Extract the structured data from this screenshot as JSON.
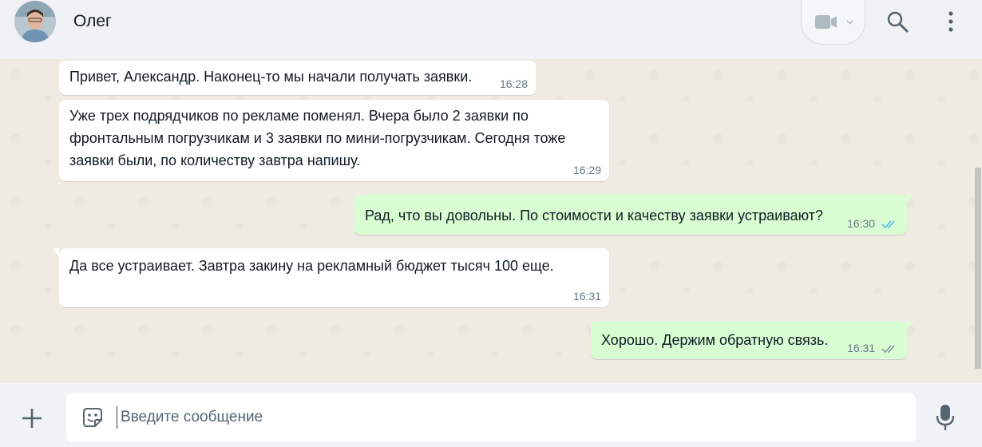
{
  "header": {
    "contact_name": "Олег",
    "icons": {
      "video": "video-camera-icon",
      "dropdown": "chevron-down-icon",
      "search": "search-icon",
      "menu": "menu-dots-icon"
    }
  },
  "messages": [
    {
      "direction": "in",
      "text": "Привет, Александр. Наконец-то мы начали получать заявки.",
      "time": "16:28"
    },
    {
      "direction": "in",
      "text": "Уже трех подрядчиков по рекламе поменял. Вчера было 2 заявки по фронтальным погрузчикам и 3 заявки по мини-погрузчикам. Сегодня тоже заявки были, по количеству завтра напишу.",
      "time": "16:29"
    },
    {
      "direction": "out",
      "text": "Рад, что вы довольны. По стоимости и качеству заявки устраивают?",
      "time": "16:30",
      "status": "read"
    },
    {
      "direction": "in",
      "text": "Да все устраивает. Завтра закину на рекламный бюджет тысяч 100 еще.",
      "time": "16:31"
    },
    {
      "direction": "out",
      "text": "Хорошо. Держим обратную связь.",
      "time": "16:31",
      "status": "delivered"
    }
  ],
  "composer": {
    "placeholder": "Введите сообщение",
    "icons": {
      "attach": "plus-icon",
      "sticker": "sticker-icon",
      "mic": "microphone-icon"
    }
  },
  "colors": {
    "header_bg": "#f0f2f5",
    "chat_bg": "#efeae2",
    "incoming_bubble": "#ffffff",
    "outgoing_bubble": "#d9fdd3",
    "read_ticks": "#53bdeb",
    "delivered_ticks": "#8696a0"
  }
}
